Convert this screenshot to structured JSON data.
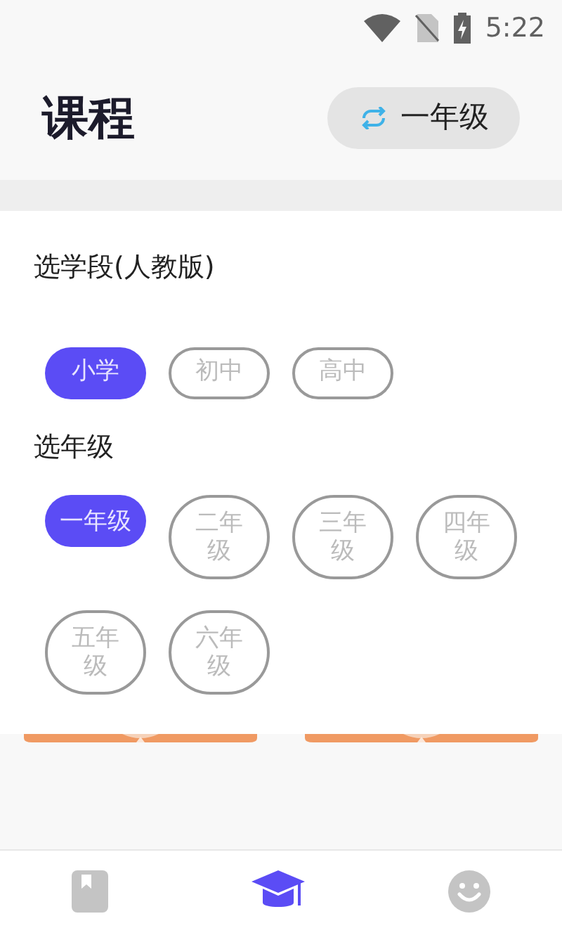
{
  "status_bar": {
    "time": "5:22"
  },
  "header": {
    "title": "课程",
    "grade_button": "一年级"
  },
  "stage_section": {
    "title": "选学段(人教版)",
    "options": [
      {
        "label": "小学",
        "selected": true
      },
      {
        "label": "初中",
        "selected": false
      },
      {
        "label": "高中",
        "selected": false
      }
    ]
  },
  "grade_section": {
    "title": "选年级",
    "options": [
      {
        "label": "一年级",
        "selected": true
      },
      {
        "label": "二年级",
        "selected": false
      },
      {
        "label": "三年级",
        "selected": false
      },
      {
        "label": "四年级",
        "selected": false
      },
      {
        "label": "五年级",
        "selected": false
      },
      {
        "label": "六年级",
        "selected": false
      }
    ]
  },
  "bottom_nav": [
    {
      "kind": "book",
      "selected": false
    },
    {
      "kind": "cap",
      "selected": true
    },
    {
      "kind": "smile",
      "selected": false
    }
  ]
}
